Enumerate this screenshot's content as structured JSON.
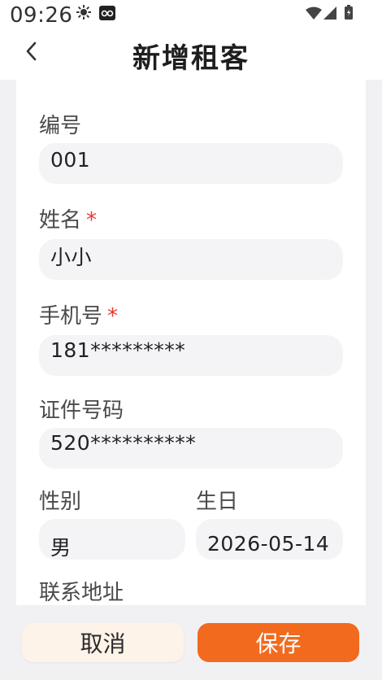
{
  "status_bar": {
    "time": "09:26",
    "icons": [
      "sun-icon",
      "app-notification-icon",
      "wifi-icon",
      "signal-icon",
      "battery-icon"
    ]
  },
  "header": {
    "title": "新增租客",
    "back_icon": "chevron-left-icon"
  },
  "form": {
    "number": {
      "label": "编号",
      "value": "001"
    },
    "name": {
      "label": "姓名",
      "required_mark": "*",
      "value": "小小"
    },
    "phone": {
      "label": "手机号",
      "required_mark": "*",
      "value": "181*********"
    },
    "id_number": {
      "label": "证件号码",
      "value": "520**********"
    },
    "gender": {
      "label": "性别",
      "value": "男"
    },
    "birthday": {
      "label": "生日",
      "value": "2026-05-14"
    },
    "address": {
      "label": "联系地址"
    }
  },
  "actions": {
    "cancel_label": "取消",
    "save_label": "保存"
  },
  "colors": {
    "accent": "#f26a1e",
    "required": "#e53935",
    "cancel_bg": "#fdf3e9",
    "field_bg": "#f4f4f6",
    "page_bg": "#f1f1f3"
  }
}
